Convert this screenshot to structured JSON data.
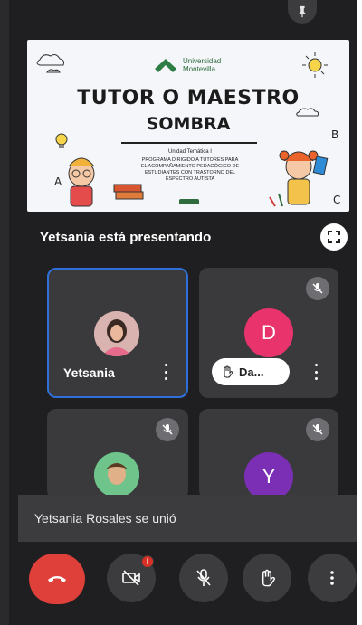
{
  "slide": {
    "university_name_line1": "Universidad",
    "university_name_line2": "Montevilla",
    "title_line1": "TUTOR O MAESTRO",
    "title_line2": "SOMBRA",
    "unit": "Unidad Temática I",
    "subtitle_lines": [
      "PROGRAMA DIRIGIDO A TUTORES PARA",
      "EL ACOMPAÑAMIENTO PEDAGÓGICO DE",
      "ESTUDIANTES CON TRASTORNO DEL",
      "ESPECTRO AUTISTA"
    ],
    "letters": [
      "A",
      "B",
      "C"
    ]
  },
  "presenting_text": "Yetsania está presentando",
  "participants": [
    {
      "name": "Yetsania",
      "type": "photo",
      "active": true
    },
    {
      "name": "Da...",
      "initial": "D",
      "color": "#e8336d",
      "hand_raised": true,
      "muted": true
    },
    {
      "name": "",
      "type": "photo",
      "muted": true
    },
    {
      "name": "",
      "initial": "Y",
      "color": "#7b2fb5",
      "muted": true
    }
  ],
  "toast": "Yetsania Rosales se unió",
  "controls": {
    "video_badge": "!"
  },
  "icons": [
    "pin-icon",
    "fullscreen-icon",
    "mic-off-icon",
    "hand-icon",
    "more-vert-icon",
    "end-call-icon",
    "video-off-icon"
  ]
}
